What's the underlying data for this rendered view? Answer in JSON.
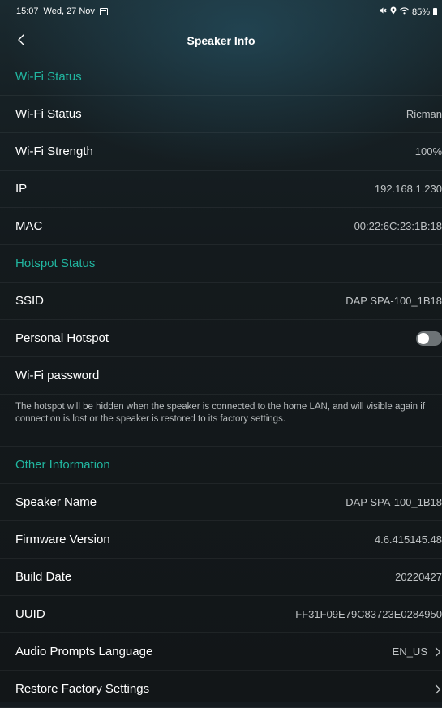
{
  "status_bar": {
    "time": "15:07",
    "date": "Wed, 27 Nov",
    "battery": "85%"
  },
  "nav": {
    "title": "Speaker Info"
  },
  "sections": {
    "wifi_header": "Wi-Fi Status",
    "hotspot_header": "Hotspot Status",
    "other_header": "Other Information"
  },
  "rows": {
    "wifi_status": {
      "label": "Wi-Fi Status",
      "value": "Ricman"
    },
    "wifi_strength": {
      "label": "Wi-Fi Strength",
      "value": "100%"
    },
    "ip": {
      "label": "IP",
      "value": "192.168.1.230"
    },
    "mac": {
      "label": "MAC",
      "value": "00:22:6C:23:1B:18"
    },
    "ssid": {
      "label": "SSID",
      "value": "DAP SPA-100_1B18"
    },
    "personal_hotspot": {
      "label": "Personal Hotspot",
      "enabled": false
    },
    "wifi_password": {
      "label": "Wi-Fi password"
    },
    "speaker_name": {
      "label": "Speaker Name",
      "value": "DAP SPA-100_1B18"
    },
    "firmware_version": {
      "label": "Firmware Version",
      "value": "4.6.415145.48"
    },
    "build_date": {
      "label": "Build Date",
      "value": "20220427"
    },
    "uuid": {
      "label": "UUID",
      "value": "FF31F09E79C83723E0284950"
    },
    "audio_prompts_language": {
      "label": "Audio Prompts Language",
      "value": "EN_US"
    },
    "restore_factory": {
      "label": "Restore Factory Settings"
    }
  },
  "hotspot_note": "The hotspot will be hidden when the speaker is connected to the home LAN, and will visible again if connection is lost or the speaker is restored to its factory settings.",
  "icons": {
    "back": "chevron-left-icon",
    "chevron": "chevron-right-icon",
    "calendar": "calendar-icon",
    "mute": "mute-icon",
    "location": "location-icon",
    "wifi": "wifi-icon",
    "battery": "battery-icon"
  },
  "colors": {
    "accent": "#21b6a0",
    "background": "#151b1f",
    "toggle_off": "#6d7376"
  }
}
